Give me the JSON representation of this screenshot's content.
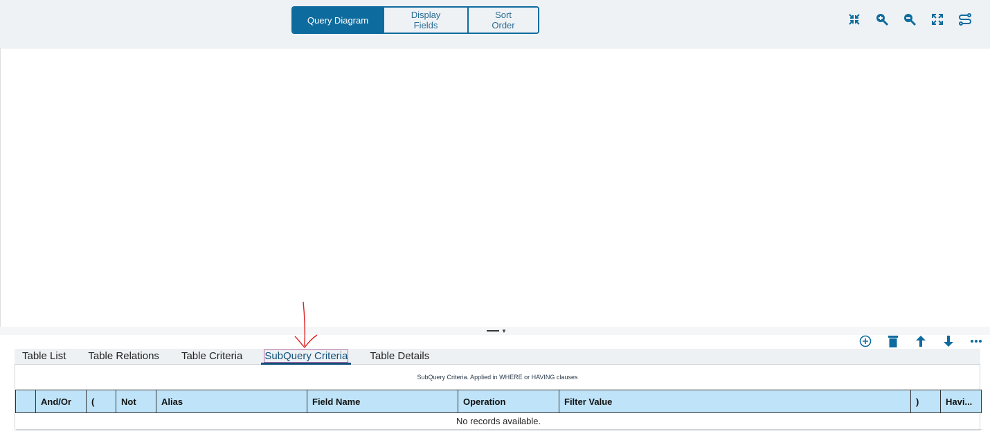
{
  "top_tabs": [
    {
      "label": "Query Diagram",
      "active": true
    },
    {
      "label": "Display Fields",
      "active": false
    },
    {
      "label": "Sort Order",
      "active": false
    }
  ],
  "toolbar_icons": [
    "collapse-icon",
    "zoom-in-icon",
    "zoom-out-icon",
    "fit-screen-icon",
    "route-settings-icon"
  ],
  "grid_toolbar_icons": [
    "add-circle-icon",
    "trash-icon",
    "arrow-up-icon",
    "arrow-down-icon",
    "more-icon"
  ],
  "bottom_tabs": [
    {
      "label": "Table List"
    },
    {
      "label": "Table Relations"
    },
    {
      "label": "Table Criteria"
    },
    {
      "label": "SubQuery Criteria",
      "active": true
    },
    {
      "label": "Table Details"
    }
  ],
  "grid": {
    "caption": "SubQuery Criteria. Applied in WHERE or HAVING clauses",
    "columns": [
      "",
      "And/Or",
      "(",
      "Not",
      "Alias",
      "Field Name",
      "Operation",
      "Filter Value",
      ")",
      "Havi..."
    ],
    "empty_message": "No records available."
  },
  "colors": {
    "accent": "#0e6b9e",
    "header_bg": "#bfe3f8",
    "annotation": "#e02020"
  }
}
